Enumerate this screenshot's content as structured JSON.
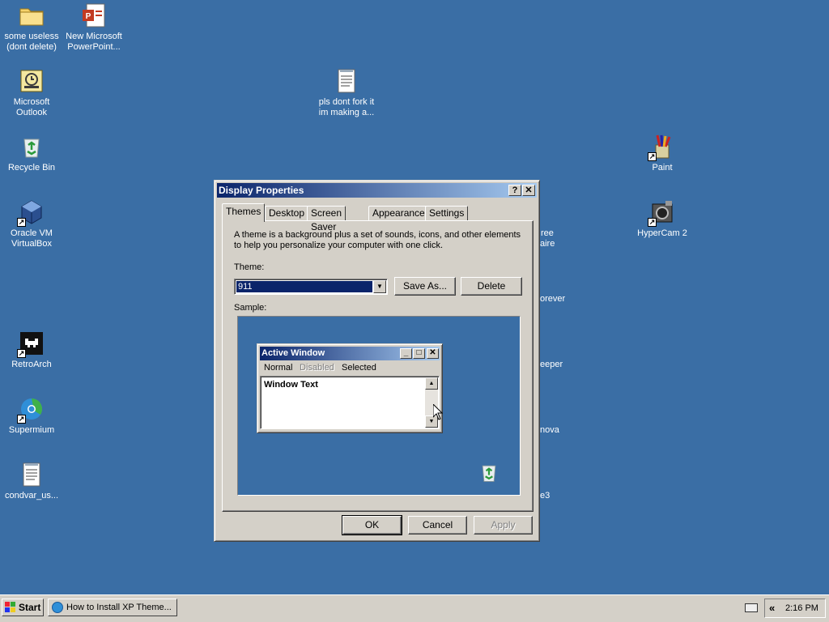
{
  "desktop": {
    "background_color": "#3a6ea5",
    "icons": [
      {
        "label": "some useless (dont delete)",
        "icon": "folder-icon"
      },
      {
        "label": "New Microsoft PowerPoint...",
        "icon": "powerpoint-icon"
      },
      {
        "label": "Microsoft Outlook",
        "icon": "outlook-icon"
      },
      {
        "label": "pls dont fork it im making a...",
        "icon": "text-file-icon"
      },
      {
        "label": "Recycle Bin",
        "icon": "recycle-bin-icon"
      },
      {
        "label": "Paint",
        "icon": "paint-icon"
      },
      {
        "label": "Oracle VM VirtualBox",
        "icon": "virtualbox-icon"
      },
      {
        "label": "HyperCam 2",
        "icon": "hypercam-icon"
      },
      {
        "label": "RetroArch",
        "icon": "retroarch-icon"
      },
      {
        "label": "Supermium",
        "icon": "supermium-icon"
      },
      {
        "label": "condvar_us...",
        "icon": "text-file-icon"
      }
    ],
    "partial_labels": [
      "ree",
      "aire",
      "orever",
      "eeper",
      "nova",
      "e3"
    ]
  },
  "dialog": {
    "title": "Display Properties",
    "help_button": "?",
    "close_button": "✕",
    "tabs": [
      "Themes",
      "Desktop",
      "Screen Saver",
      "Appearance",
      "Settings"
    ],
    "active_tab": "Themes",
    "description": "A theme is a background plus a set of sounds, icons, and other elements to help you personalize your computer with one click.",
    "theme_label": "Theme:",
    "theme_value": "911",
    "save_as_label": "Save As...",
    "delete_label": "Delete",
    "sample_label": "Sample:",
    "ok_label": "OK",
    "cancel_label": "Cancel",
    "apply_label": "Apply"
  },
  "sample": {
    "window_title": "Active Window",
    "menu": [
      "Normal",
      "Disabled",
      "Selected"
    ],
    "window_text": "Window Text"
  },
  "taskbar": {
    "start_label": "Start",
    "task_label": "How to Install XP Theme...",
    "tray_chevron": "«",
    "clock": "2:16 PM"
  },
  "colors": {
    "title_active_start": "#0a246a",
    "title_active_end": "#a6caf0",
    "face": "#d4d0c8"
  }
}
